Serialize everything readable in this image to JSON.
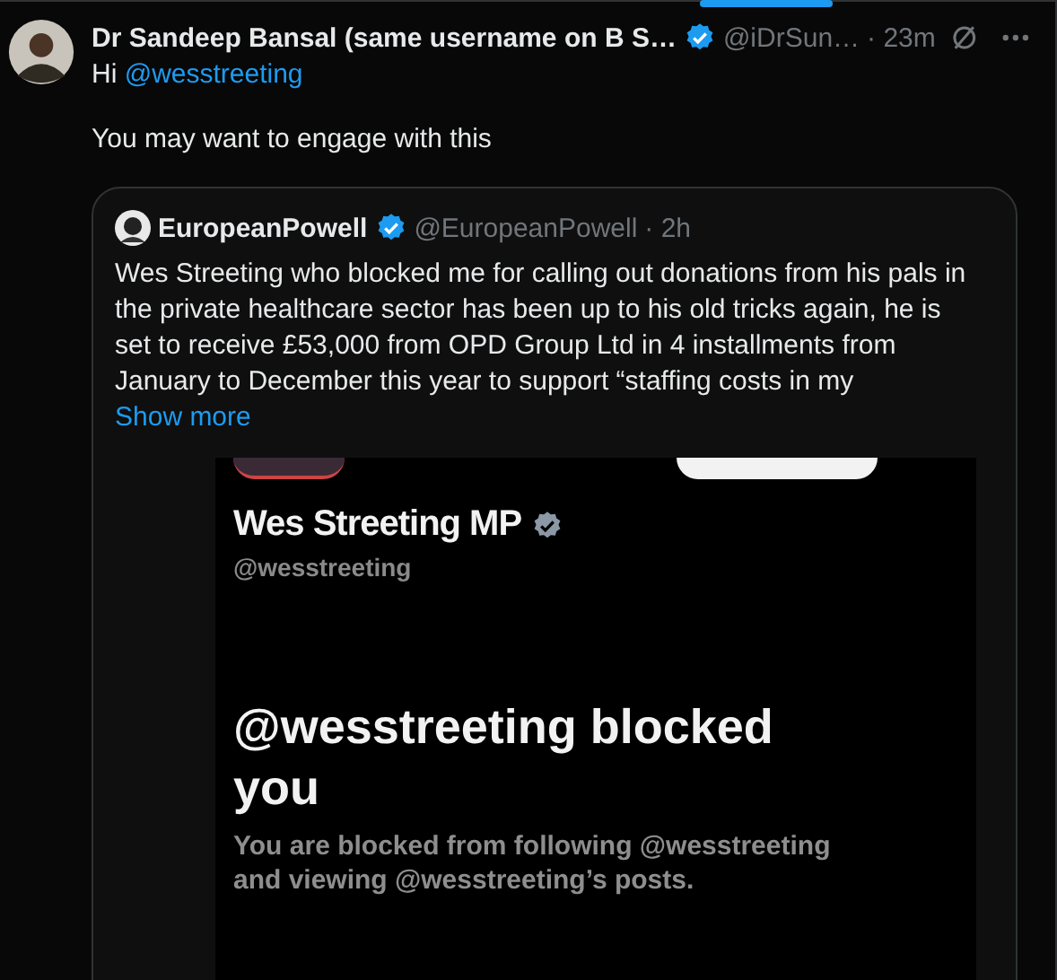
{
  "post": {
    "author": "Dr Sandeep Bansal (same username on B S…",
    "verified": true,
    "handle": "@iDrSun…",
    "time": "· 23m",
    "text_lines": [
      {
        "prefix": "Hi ",
        "mention": "@wesstreeting"
      },
      {
        "prefix": "You may want to engage with this"
      }
    ]
  },
  "quote": {
    "author": "EuropeanPowell",
    "verified": true,
    "handle": "@EuropeanPowell",
    "time": "· 2h",
    "text": "Wes Streeting who blocked me for calling out donations from his pals in the private healthcare sector has been up to his old tricks again, he is set to receive £53,000 from OPD Group Ltd in 4 installments from January to December this year to support “staffing costs in my",
    "show_more": "Show more"
  },
  "screenshot": {
    "name": "Wes Streeting MP",
    "verified": true,
    "handle": "@wesstreeting",
    "headline": "@wesstreeting blocked you",
    "message": "You are blocked from following @wesstreeting and viewing @wesstreeting’s posts."
  }
}
